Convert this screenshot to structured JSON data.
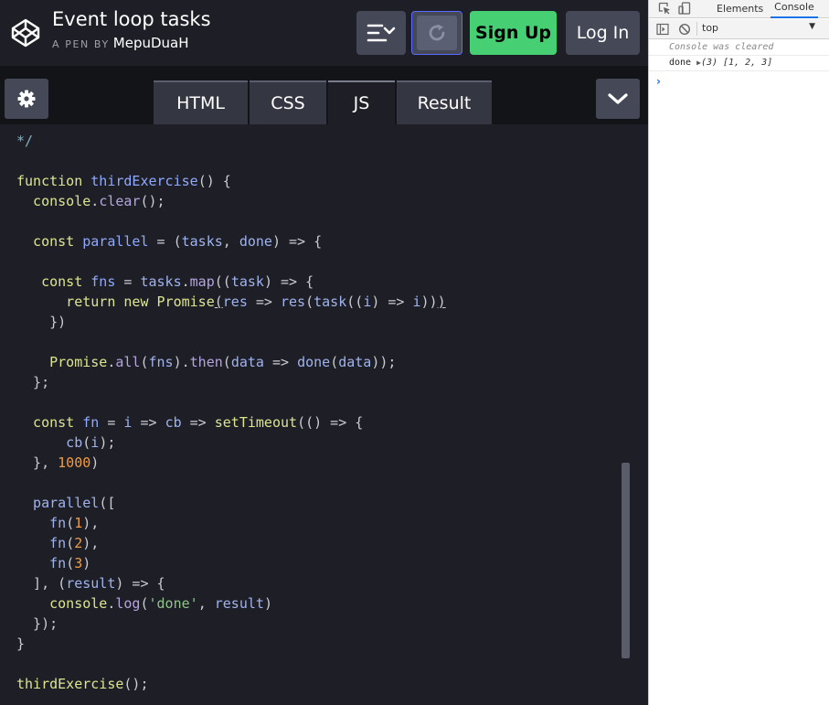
{
  "header": {
    "title": "Event loop tasks",
    "byline_prefix": "A PEN BY",
    "author": "MepuDuaH",
    "signup_label": "Sign Up",
    "login_label": "Log In"
  },
  "icons": {
    "logo": "codepen-logo-icon",
    "layout": "layout-menu-icon",
    "run": "refresh-icon",
    "settings": "gear-icon",
    "collapse": "chevron-down-icon"
  },
  "tabs": [
    {
      "label": "HTML"
    },
    {
      "label": "CSS"
    },
    {
      "label": "JS"
    },
    {
      "label": "Result"
    }
  ],
  "active_tab": "JS",
  "colors": {
    "signup": "#47cf73",
    "button": "#444857",
    "editor_bg": "#1e1f26",
    "run_border": "#5c6bff"
  },
  "code": {
    "lines": [
      [
        {
          "t": "*/",
          "c": "comment"
        }
      ],
      [],
      [
        {
          "t": "function ",
          "c": "keyword"
        },
        {
          "t": "thirdExercise",
          "c": "def"
        },
        {
          "t": "() {",
          "c": "punct"
        }
      ],
      [
        {
          "t": "  console",
          "c": "fn"
        },
        {
          "t": ".",
          "c": "punct"
        },
        {
          "t": "clear",
          "c": "prop"
        },
        {
          "t": "();",
          "c": "punct"
        }
      ],
      [],
      [
        {
          "t": "  const ",
          "c": "keyword"
        },
        {
          "t": "parallel",
          "c": "def"
        },
        {
          "t": " = (",
          "c": "punct"
        },
        {
          "t": "tasks",
          "c": "var"
        },
        {
          "t": ", ",
          "c": "punct"
        },
        {
          "t": "done",
          "c": "var"
        },
        {
          "t": ") => {",
          "c": "punct"
        }
      ],
      [],
      [
        {
          "t": "   const ",
          "c": "keyword"
        },
        {
          "t": "fns",
          "c": "def"
        },
        {
          "t": " = ",
          "c": "punct"
        },
        {
          "t": "tasks",
          "c": "var"
        },
        {
          "t": ".",
          "c": "punct"
        },
        {
          "t": "map",
          "c": "prop"
        },
        {
          "t": "((",
          "c": "punct"
        },
        {
          "t": "task",
          "c": "var"
        },
        {
          "t": ") => {",
          "c": "punct"
        }
      ],
      [
        {
          "t": "      return new ",
          "c": "keyword"
        },
        {
          "t": "Promise",
          "c": "fn"
        },
        {
          "t": "(",
          "c": "ul"
        },
        {
          "t": "res",
          "c": "var"
        },
        {
          "t": " => ",
          "c": "punct"
        },
        {
          "t": "res",
          "c": "var"
        },
        {
          "t": "(",
          "c": "punct"
        },
        {
          "t": "task",
          "c": "var"
        },
        {
          "t": "((",
          "c": "punct"
        },
        {
          "t": "i",
          "c": "var"
        },
        {
          "t": ") => ",
          "c": "punct"
        },
        {
          "t": "i",
          "c": "var"
        },
        {
          "t": "))",
          "c": "punct"
        },
        {
          "t": ")",
          "c": "ul"
        }
      ],
      [
        {
          "t": "    })",
          "c": "punct"
        }
      ],
      [],
      [
        {
          "t": "    Promise",
          "c": "fn"
        },
        {
          "t": ".",
          "c": "punct"
        },
        {
          "t": "all",
          "c": "prop"
        },
        {
          "t": "(",
          "c": "punct"
        },
        {
          "t": "fns",
          "c": "var"
        },
        {
          "t": ").",
          "c": "punct"
        },
        {
          "t": "then",
          "c": "prop"
        },
        {
          "t": "(",
          "c": "punct"
        },
        {
          "t": "data",
          "c": "var"
        },
        {
          "t": " => ",
          "c": "punct"
        },
        {
          "t": "done",
          "c": "var"
        },
        {
          "t": "(",
          "c": "punct"
        },
        {
          "t": "data",
          "c": "var"
        },
        {
          "t": "));",
          "c": "punct"
        }
      ],
      [
        {
          "t": "  };",
          "c": "punct"
        }
      ],
      [],
      [
        {
          "t": "  const ",
          "c": "keyword"
        },
        {
          "t": "fn",
          "c": "def"
        },
        {
          "t": " = ",
          "c": "punct"
        },
        {
          "t": "i",
          "c": "var"
        },
        {
          "t": " => ",
          "c": "punct"
        },
        {
          "t": "cb",
          "c": "var"
        },
        {
          "t": " => ",
          "c": "punct"
        },
        {
          "t": "setTimeout",
          "c": "fn"
        },
        {
          "t": "(() => {",
          "c": "punct"
        }
      ],
      [
        {
          "t": "      cb",
          "c": "var"
        },
        {
          "t": "(",
          "c": "punct"
        },
        {
          "t": "i",
          "c": "var"
        },
        {
          "t": ");",
          "c": "punct"
        }
      ],
      [
        {
          "t": "  }, ",
          "c": "punct"
        },
        {
          "t": "1000",
          "c": "number"
        },
        {
          "t": ")",
          "c": "punct"
        }
      ],
      [],
      [
        {
          "t": "  parallel",
          "c": "var"
        },
        {
          "t": "([",
          "c": "punct"
        }
      ],
      [
        {
          "t": "    fn",
          "c": "var"
        },
        {
          "t": "(",
          "c": "punct"
        },
        {
          "t": "1",
          "c": "number"
        },
        {
          "t": "),",
          "c": "punct"
        }
      ],
      [
        {
          "t": "    fn",
          "c": "var"
        },
        {
          "t": "(",
          "c": "punct"
        },
        {
          "t": "2",
          "c": "number"
        },
        {
          "t": "),",
          "c": "punct"
        }
      ],
      [
        {
          "t": "    fn",
          "c": "var"
        },
        {
          "t": "(",
          "c": "punct"
        },
        {
          "t": "3",
          "c": "number"
        },
        {
          "t": ")",
          "c": "punct"
        }
      ],
      [
        {
          "t": "  ], (",
          "c": "punct"
        },
        {
          "t": "result",
          "c": "var"
        },
        {
          "t": ") => {",
          "c": "punct"
        }
      ],
      [
        {
          "t": "    console",
          "c": "fn"
        },
        {
          "t": ".",
          "c": "punct"
        },
        {
          "t": "log",
          "c": "prop"
        },
        {
          "t": "(",
          "c": "punct"
        },
        {
          "t": "'done'",
          "c": "string"
        },
        {
          "t": ", ",
          "c": "punct"
        },
        {
          "t": "result",
          "c": "var"
        },
        {
          "t": ")",
          "c": "punct"
        }
      ],
      [
        {
          "t": "  });",
          "c": "punct"
        }
      ],
      [
        {
          "t": "}",
          "c": "punct"
        }
      ],
      [],
      [
        {
          "t": "thirdExercise",
          "c": "fn"
        },
        {
          "t": "();",
          "c": "punct"
        }
      ]
    ]
  },
  "devtools": {
    "tabs": {
      "elements": "Elements",
      "console": "Console"
    },
    "context": "top",
    "context_arrow": "▼",
    "cleared_message": "Console was cleared",
    "log_label": "done",
    "log_arrow": "▶",
    "log_value": "(3) [1, 2, 3]",
    "prompt": "›"
  }
}
